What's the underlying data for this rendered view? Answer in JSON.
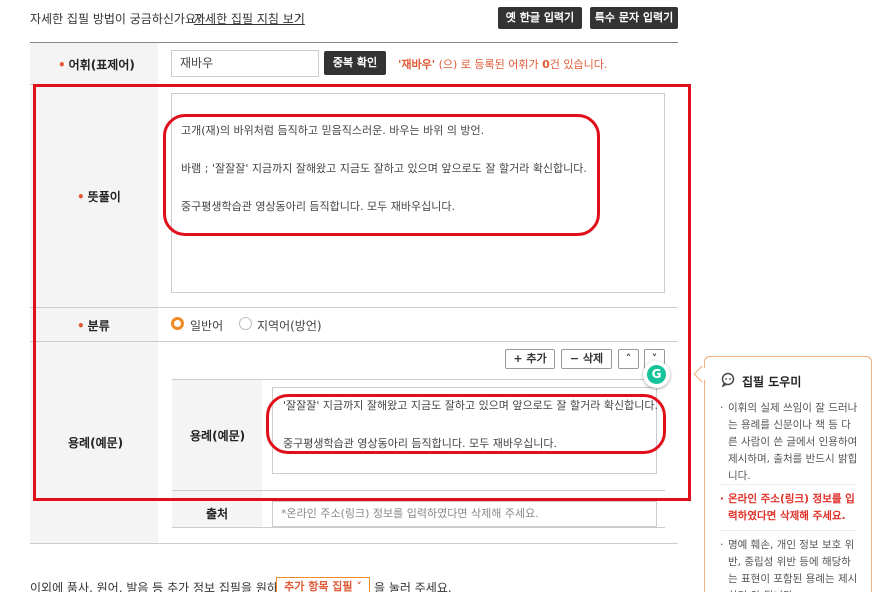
{
  "topbar": {
    "help_text": "자세한 집필 방법이 궁금하신가요?",
    "guide_link": "자세한 집필 지침 보기",
    "chevron": "›",
    "old_hangul_button": "옛 한글 입력기",
    "special_char_button": "특수 문자 입력기"
  },
  "headword": {
    "label": "어휘(표제어)",
    "value": "재바우",
    "check_button": "중복 확인",
    "msg_word": "'재바우'",
    "msg_rest": " (으) 로 등록된 어휘가 ",
    "msg_count": "0",
    "msg_end": "건 있습니다."
  },
  "meaning": {
    "label": "뜻풀이",
    "lines": [
      "고개(재)의 바위처럼 듬직하고 믿음직스러운. 바우는 바위 의 방언.",
      "",
      "바램 ; '잘잘잘' 지금까지 잘해왔고 지금도 잘하고 있으며 앞으로도 잘 할거라 확신합니다.",
      "",
      "중구평생학습관 영상동아리 듬직합니다. 모두 재바우십니다."
    ]
  },
  "category": {
    "label": "분류",
    "option1": "일반어",
    "option2": "지역어(방언)"
  },
  "example": {
    "label": "용례(예문)",
    "add_button": "+ 추가",
    "delete_button": "− 삭제",
    "up_icon": "˄",
    "down_icon": "˅",
    "inner_label": "용례(예문)",
    "lines": [
      "'잘잘잘' 지금까지 잘해왔고 지금도 잘하고 있으며 앞으로도 잘 할거라 확신합니다.",
      "",
      "중구평생학습관 영상동아리 듬직합니다. 모두 재바우십니다."
    ],
    "source_label": "출처",
    "source_placeholder": "*온라인 주소(링크) 정보를 입력하였다면 삭제해 주세요."
  },
  "grammarly": {
    "glyph": "G"
  },
  "helper": {
    "title": "집필 도우미",
    "bullet": "·",
    "item1": "이휘의 실제 쓰임이 잘 드러나는 용례를 신문이나 책 등 다른 사람이 쓴 글에서 인용하여 제시하며, 출처를 반드시 밝힙니다.",
    "item2": "온라인 주소(링크) 정보를 입력하였다면 삭제해 주세요.",
    "item3": "명예 훼손, 개인 정보 보호 위반, 중립성 위반 등에 해당하는 표현이 포함된 용례는 제시하면 안 됩니다."
  },
  "bottom": {
    "text_before": "이외에 품사, 원어, 발음 등 추가 정보 집필을 원하시면",
    "button": "추가 항목 집필  ˅",
    "text_after": "을 눌러 주세요."
  },
  "colors": {
    "accent": "#e05a36",
    "annotation_red": "#e0101a",
    "dark_button": "#333333",
    "grammarly_green": "#15c39a"
  }
}
